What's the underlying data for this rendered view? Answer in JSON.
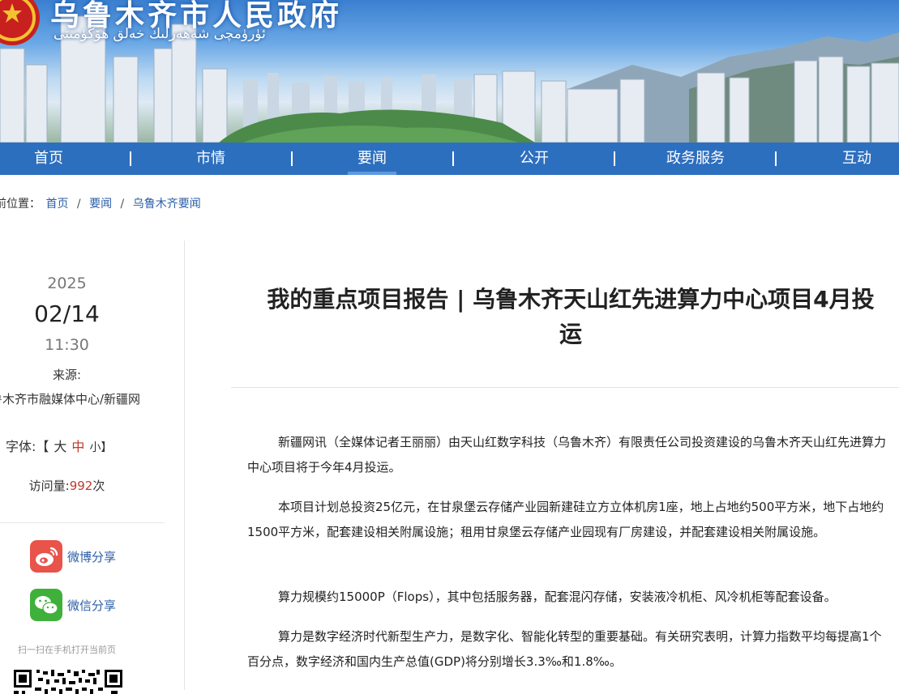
{
  "header": {
    "title_cn": "乌鲁木齐市人民政府",
    "title_ug": "ئۈرۈمچى شەھەرلىك خەلق ھۆكۈمىتى"
  },
  "nav": {
    "items": [
      {
        "label": "首页"
      },
      {
        "label": "市情"
      },
      {
        "label": "要闻"
      },
      {
        "label": "公开"
      },
      {
        "label": "政务服务"
      },
      {
        "label": "互动"
      }
    ],
    "active_index": 2
  },
  "breadcrumb": {
    "prefix": "前位置：",
    "items": [
      "首页",
      "要闻",
      "乌鲁木齐要闻"
    ],
    "separator": "/"
  },
  "sidebar": {
    "year": "2025",
    "month_day": "02/14",
    "time": "11:30",
    "source_label": "来源:",
    "source": "鲁木齐市融媒体中心/新疆网",
    "font_label": "字体:【",
    "font_large": "大",
    "font_medium": "中",
    "font_small": "小】",
    "visits_label": "访问量:",
    "visits_count": "992",
    "visits_unit": "次",
    "weibo_share": "微博分享",
    "wechat_share": "微信分享",
    "scan_hint": "扫一扫在手机打开当前页"
  },
  "article": {
    "title": "我的重点项目报告 | 乌鲁木齐天山红先进算力中心项目4月投运",
    "paragraphs": [
      "新疆网讯（全媒体记者王丽丽）由天山红数字科技（乌鲁木齐）有限责任公司投资建设的乌鲁木齐天山红先进算力中心项目将于今年4月投运。",
      "本项目计划总投资25亿元，在甘泉堡云存储产业园新建硅立方立体机房1座，地上占地约500平方米，地下占地约1500平方米，配套建设相关附属设施；租用甘泉堡云存储产业园现有厂房建设，并配套建设相关附属设施。",
      "算力规模约15000P（Flops），其中包括服务器，配套混闪存储，安装液冷机柜、风冷机柜等配套设备。",
      "算力是数字经济时代新型生产力，是数字化、智能化转型的重要基础。有关研究表明，计算力指数平均每提高1个百分点，数字经济和国内生产总值(GDP)将分别增长3.3‰和1.8‰。"
    ]
  },
  "colors": {
    "nav_bg": "#2d6fbf",
    "link": "#2a5ea8",
    "highlight": "#c0392b",
    "weibo": "#e8534a",
    "wechat": "#3fb13a"
  }
}
